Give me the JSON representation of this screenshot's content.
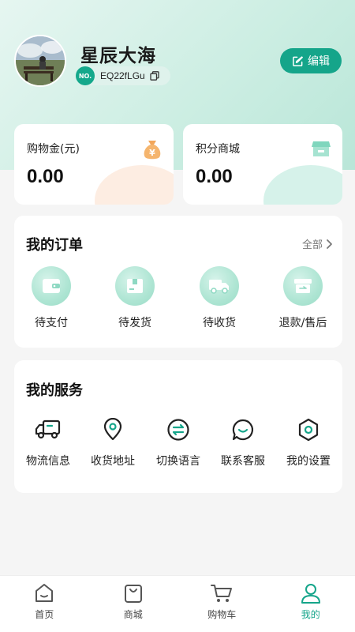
{
  "profile": {
    "username": "星辰大海",
    "no_badge": "NO.",
    "member_code": "EQ22fLGu",
    "edit_label": "编辑"
  },
  "stats": [
    {
      "label": "购物金(元)",
      "value": "0.00",
      "icon": "money-bag-icon"
    },
    {
      "label": "积分商城",
      "value": "0.00",
      "icon": "store-icon"
    }
  ],
  "orders": {
    "title": "我的订单",
    "view_all": "全部",
    "items": [
      {
        "label": "待支付",
        "icon": "wallet-icon"
      },
      {
        "label": "待发货",
        "icon": "box-icon"
      },
      {
        "label": "待收货",
        "icon": "truck-icon"
      },
      {
        "label": "退款/售后",
        "icon": "refund-icon"
      }
    ]
  },
  "services": {
    "title": "我的服务",
    "items": [
      {
        "label": "物流信息",
        "icon": "truck-outline-icon"
      },
      {
        "label": "收货地址",
        "icon": "location-pin-icon"
      },
      {
        "label": "切换语言",
        "icon": "switch-arrows-icon"
      },
      {
        "label": "联系客服",
        "icon": "chat-bubble-icon"
      },
      {
        "label": "我的设置",
        "icon": "hexagon-settings-icon"
      }
    ]
  },
  "tabbar": [
    {
      "label": "首页",
      "icon": "home-icon",
      "active": false
    },
    {
      "label": "商城",
      "icon": "shopping-bag-icon",
      "active": false
    },
    {
      "label": "购物车",
      "icon": "cart-icon",
      "active": false
    },
    {
      "label": "我的",
      "icon": "user-icon",
      "active": true
    }
  ],
  "colors": {
    "accent": "#15a58a",
    "hero_gradient_start": "#e6f6f1",
    "hero_gradient_end": "#b9e6d8"
  }
}
